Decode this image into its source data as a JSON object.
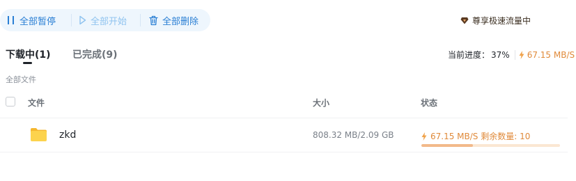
{
  "toolbar": {
    "pause_all": "全部暂停",
    "start_all": "全部开始",
    "delete_all": "全部删除"
  },
  "vip": {
    "label": "尊享极速流量中"
  },
  "tabs": {
    "downloading": "下载中(1)",
    "completed": "已完成(9)"
  },
  "progress": {
    "label": "当前进度：",
    "percent": "37%",
    "speed": "67.15 MB/S"
  },
  "section_label": "全部文件",
  "table": {
    "headers": {
      "file": "文件",
      "size": "大小",
      "status": "状态"
    },
    "rows": [
      {
        "name": "zkd",
        "size": "808.32 MB/2.09 GB",
        "status": "67.15 MB/S 剩余数量: 10",
        "progress": 0.37
      }
    ]
  },
  "colors": {
    "accent": "#2a7fd4",
    "speed": "#e08a3a",
    "progress_fill": "#f2b98a"
  }
}
